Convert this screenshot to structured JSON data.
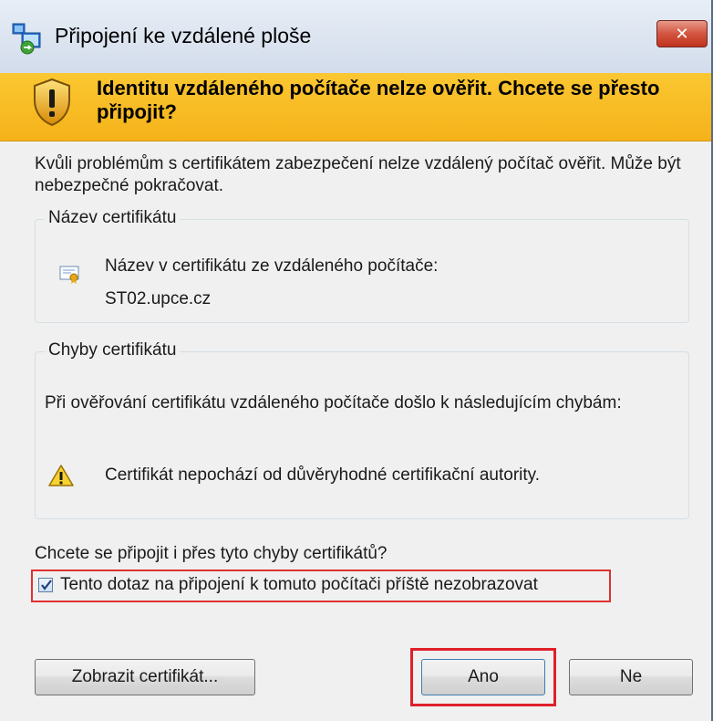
{
  "window": {
    "title": "Připojení ke vzdálené ploše",
    "close_label": "✕",
    "icon": "remote-desktop-icon"
  },
  "banner": {
    "icon": "shield-warning-icon",
    "text": "Identitu vzdáleného počítače nelze ověřit. Chcete se přesto připojit?",
    "color": "#f7b924"
  },
  "message": "Kvůli problémům s certifikátem zabezpečení nelze vzdálený počítač ověřit. Může být nebezpečné pokračovat.",
  "certificate_name_group": {
    "legend": "Název certifikátu",
    "icon": "certificate-icon",
    "label": "Název v certifikátu ze vzdáleného počítače:",
    "value": "ST02.upce.cz"
  },
  "certificate_errors_group": {
    "legend": "Chyby certifikátu",
    "description": "Při ověřování certifikátu vzdáleného počítače došlo k následujícím chybám:",
    "icon": "warning-icon",
    "error": "Certifikát nepochází od důvěryhodné certifikační autority."
  },
  "question": "Chcete se připojit i přes tyto chyby certifikátů?",
  "checkbox": {
    "label": "Tento dotaz na připojení k tomuto počítači příště nezobrazovat",
    "checked": true
  },
  "buttons": {
    "show_certificate": "Zobrazit certifikát...",
    "yes": "Ano",
    "no": "Ne"
  },
  "highlight_color": "#e0202a"
}
